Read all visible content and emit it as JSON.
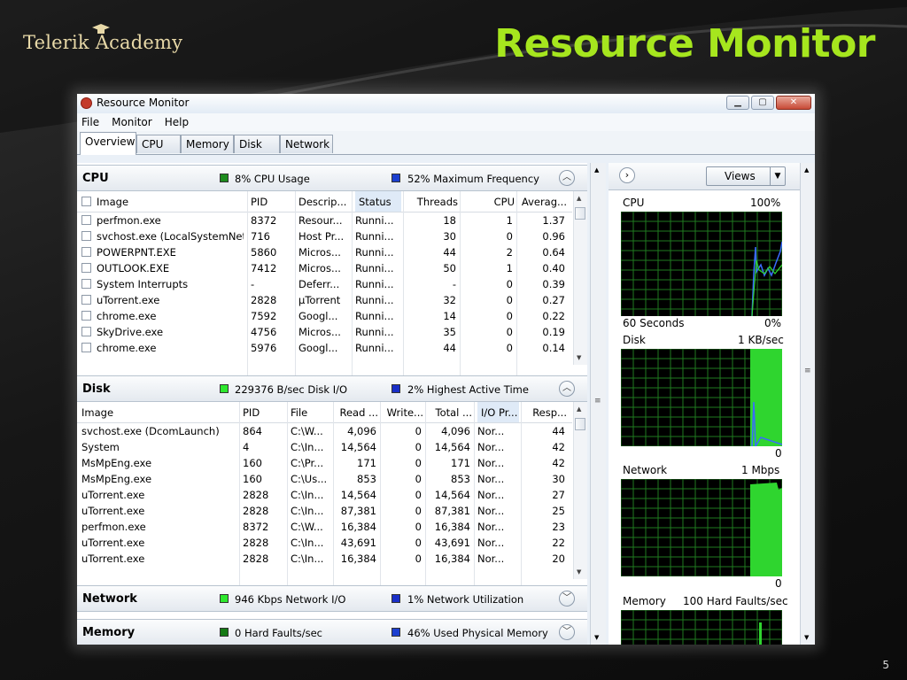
{
  "slide": {
    "brand": "Telerik Academy",
    "title": "Resource Monitor",
    "page_number": "5"
  },
  "window": {
    "title": "Resource Monitor",
    "menu": [
      "File",
      "Monitor",
      "Help"
    ],
    "tabs": [
      "Overview",
      "CPU",
      "Memory",
      "Disk",
      "Network"
    ],
    "active_tab": "Overview"
  },
  "cpu": {
    "name": "CPU",
    "usage": "8% CPU Usage",
    "usage_color": "#1e8c1e",
    "frequency": "52% Maximum Frequency",
    "frequency_color": "#1c3fd0",
    "columns": [
      "Image",
      "PID",
      "Descrip...",
      "Status",
      "Threads",
      "CPU",
      "Averag..."
    ],
    "rows": [
      [
        "perfmon.exe",
        "8372",
        "Resour...",
        "Runni...",
        "18",
        "1",
        "1.37"
      ],
      [
        "svchost.exe (LocalSystemNet...",
        "716",
        "Host Pr...",
        "Runni...",
        "30",
        "0",
        "0.96"
      ],
      [
        "POWERPNT.EXE",
        "5860",
        "Micros...",
        "Runni...",
        "44",
        "2",
        "0.64"
      ],
      [
        "OUTLOOK.EXE",
        "7412",
        "Micros...",
        "Runni...",
        "50",
        "1",
        "0.40"
      ],
      [
        "System Interrupts",
        "-",
        "Deferr...",
        "Runni...",
        "-",
        "0",
        "0.39"
      ],
      [
        "uTorrent.exe",
        "2828",
        "µTorrent",
        "Runni...",
        "32",
        "0",
        "0.27"
      ],
      [
        "chrome.exe",
        "7592",
        "Googl...",
        "Runni...",
        "14",
        "0",
        "0.22"
      ],
      [
        "SkyDrive.exe",
        "4756",
        "Micros...",
        "Runni...",
        "35",
        "0",
        "0.19"
      ],
      [
        "chrome.exe",
        "5976",
        "Googl...",
        "Runni...",
        "44",
        "0",
        "0.14"
      ]
    ]
  },
  "disk": {
    "name": "Disk",
    "io": "229376 B/sec Disk I/O",
    "io_color": "#2ee82e",
    "active": "2% Highest Active Time",
    "active_color": "#1a2fc8",
    "columns": [
      "Image",
      "PID",
      "File",
      "Read ...",
      "Write...",
      "Total ...",
      "I/O Pr...",
      "Resp..."
    ],
    "rows": [
      [
        "svchost.exe (DcomLaunch)",
        "864",
        "C:\\W...",
        "4,096",
        "0",
        "4,096",
        "Nor...",
        "44"
      ],
      [
        "System",
        "4",
        "C:\\In...",
        "14,564",
        "0",
        "14,564",
        "Nor...",
        "42"
      ],
      [
        "MsMpEng.exe",
        "160",
        "C:\\Pr...",
        "171",
        "0",
        "171",
        "Nor...",
        "42"
      ],
      [
        "MsMpEng.exe",
        "160",
        "C:\\Us...",
        "853",
        "0",
        "853",
        "Nor...",
        "30"
      ],
      [
        "uTorrent.exe",
        "2828",
        "C:\\In...",
        "14,564",
        "0",
        "14,564",
        "Nor...",
        "27"
      ],
      [
        "uTorrent.exe",
        "2828",
        "C:\\In...",
        "87,381",
        "0",
        "87,381",
        "Nor...",
        "25"
      ],
      [
        "perfmon.exe",
        "8372",
        "C:\\W...",
        "16,384",
        "0",
        "16,384",
        "Nor...",
        "23"
      ],
      [
        "uTorrent.exe",
        "2828",
        "C:\\In...",
        "43,691",
        "0",
        "43,691",
        "Nor...",
        "22"
      ],
      [
        "uTorrent.exe",
        "2828",
        "C:\\In...",
        "16,384",
        "0",
        "16,384",
        "Nor...",
        "20"
      ]
    ]
  },
  "network": {
    "name": "Network",
    "io": "946 Kbps Network I/O",
    "io_color": "#2ee82e",
    "util": "1% Network Utilization",
    "util_color": "#1a2fc8"
  },
  "memory": {
    "name": "Memory",
    "faults": "0 Hard Faults/sec",
    "faults_color": "#157a15",
    "used": "46% Used Physical Memory",
    "used_color": "#1c3fd0"
  },
  "graphs": {
    "views_label": "Views",
    "cpu": {
      "label": "CPU",
      "max": "100%",
      "footer_left": "60 Seconds",
      "footer_right": "0%"
    },
    "disk": {
      "label": "Disk",
      "max": "1 KB/sec",
      "footer_right": "0"
    },
    "network": {
      "label": "Network",
      "max": "1 Mbps",
      "footer_right": "0"
    },
    "memory": {
      "label": "Memory",
      "max": "100 Hard Faults/sec"
    }
  },
  "colors": {
    "title_accent": "#a6e61e",
    "graph_grid": "#1f7a1f",
    "graph_fill": "#2fd52f",
    "graph_line": "#3a6bff"
  }
}
